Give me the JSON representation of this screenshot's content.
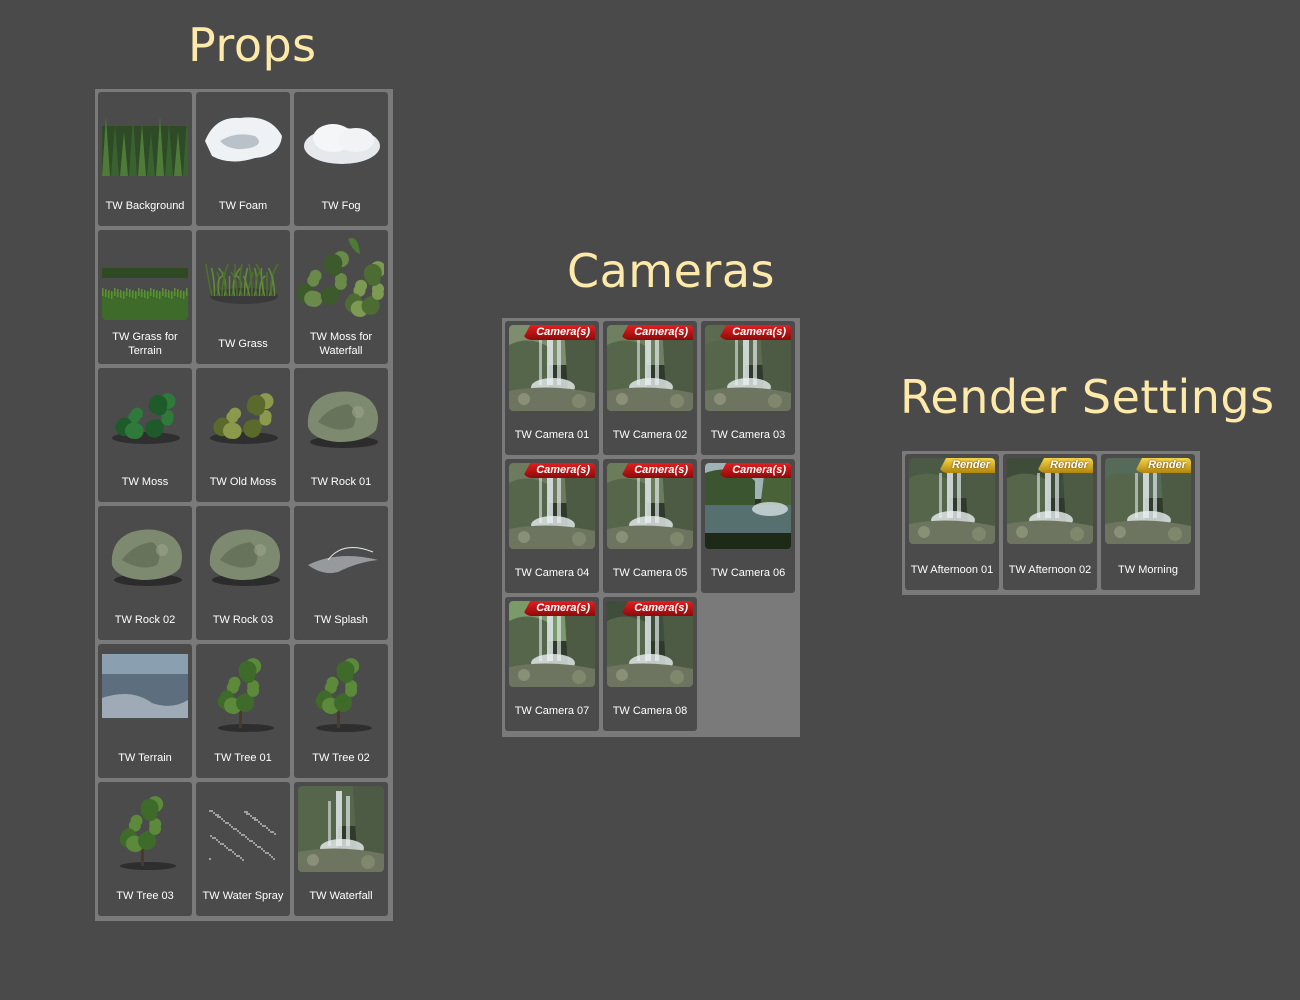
{
  "props": {
    "title": "Props",
    "items": [
      {
        "label": "TW Background",
        "icon": "forest-thumbnail-icon"
      },
      {
        "label": "TW Foam",
        "icon": "foam-thumbnail-icon"
      },
      {
        "label": "TW Fog",
        "icon": "fog-thumbnail-icon"
      },
      {
        "label": "TW Grass for Terrain",
        "icon": "grass-terrain-thumbnail-icon"
      },
      {
        "label": "TW Grass",
        "icon": "grass-thumbnail-icon"
      },
      {
        "label": "TW Moss for Waterfall",
        "icon": "moss-waterfall-thumbnail-icon"
      },
      {
        "label": "TW Moss",
        "icon": "moss-thumbnail-icon"
      },
      {
        "label": "TW Old Moss",
        "icon": "old-moss-thumbnail-icon"
      },
      {
        "label": "TW Rock 01",
        "icon": "rock-thumbnail-icon"
      },
      {
        "label": "TW Rock 02",
        "icon": "rock-thumbnail-icon"
      },
      {
        "label": "TW Rock 03",
        "icon": "rock-thumbnail-icon"
      },
      {
        "label": "TW Splash",
        "icon": "splash-thumbnail-icon"
      },
      {
        "label": "TW Terrain",
        "icon": "terrain-thumbnail-icon"
      },
      {
        "label": "TW Tree 01",
        "icon": "tree-thumbnail-icon"
      },
      {
        "label": "TW Tree 02",
        "icon": "tree-thumbnail-icon"
      },
      {
        "label": "TW Tree 03",
        "icon": "tree-thumbnail-icon"
      },
      {
        "label": "TW Water Spray",
        "icon": "water-spray-thumbnail-icon"
      },
      {
        "label": "TW Waterfall",
        "icon": "waterfall-thumbnail-icon"
      }
    ]
  },
  "cameras": {
    "title": "Cameras",
    "badge": "Camera(s)",
    "items": [
      {
        "label": "TW Camera 01"
      },
      {
        "label": "TW Camera 02"
      },
      {
        "label": "TW Camera 03"
      },
      {
        "label": "TW Camera 04"
      },
      {
        "label": "TW Camera 05"
      },
      {
        "label": "TW Camera 06"
      },
      {
        "label": "TW Camera 07"
      },
      {
        "label": "TW Camera 08"
      }
    ]
  },
  "render_settings": {
    "title": "Render Settings",
    "badge": "Render",
    "items": [
      {
        "label": "TW Afternoon 01"
      },
      {
        "label": "TW Afternoon 02"
      },
      {
        "label": "TW Morning"
      }
    ]
  },
  "colors": {
    "background": "#4a4a4a",
    "title": "#fde9a9",
    "panel": "#7a7a7a",
    "tile": "#4b4b4b",
    "camera_badge": "#c81414",
    "render_badge": "#e3b92a"
  }
}
